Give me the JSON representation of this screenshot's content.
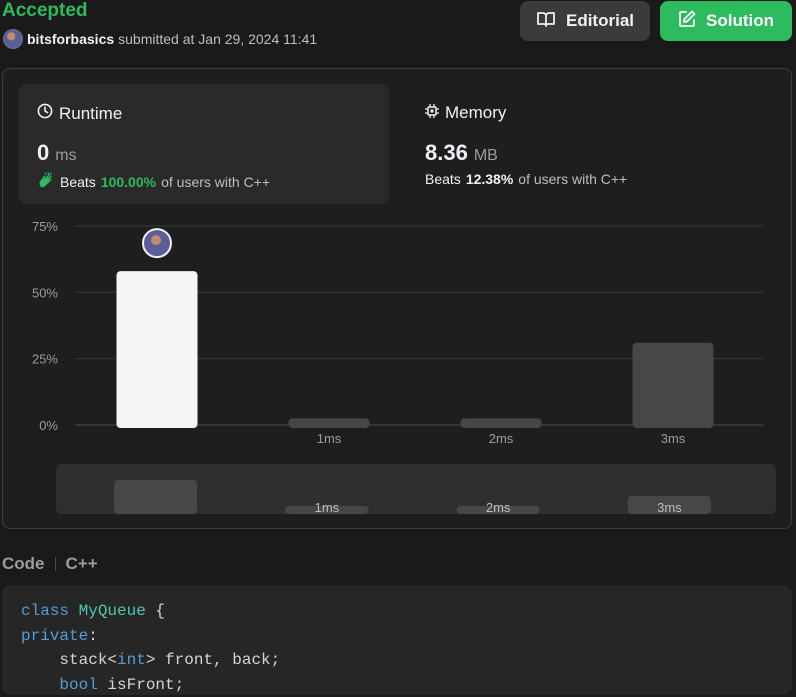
{
  "submission": {
    "status": "Accepted",
    "username": "bitsforbasics",
    "submitted_text": "submitted at Jan 29, 2024 11:41"
  },
  "buttons": {
    "editorial": "Editorial",
    "solution": "Solution"
  },
  "runtime": {
    "title": "Runtime",
    "value": "0",
    "unit": "ms",
    "beats_label": "Beats",
    "percent": "100.00%",
    "suffix": "of users with C++"
  },
  "memory": {
    "title": "Memory",
    "value": "8.36",
    "unit": "MB",
    "beats_label": "Beats",
    "percent": "12.38%",
    "suffix": "of users with C++"
  },
  "chart_data": {
    "type": "bar",
    "yticks": [
      "75%",
      "50%",
      "25%",
      "0%"
    ],
    "ylim": [
      0,
      75
    ],
    "categories": [
      "",
      "1ms",
      "2ms",
      "3ms"
    ],
    "values": [
      58,
      2.5,
      2.5,
      31
    ],
    "highlight_index": 0,
    "grid": true
  },
  "overview": {
    "labels": [
      "",
      "1ms",
      "2ms",
      "3ms"
    ]
  },
  "code": {
    "section_label": "Code",
    "language": "C++",
    "lines": [
      [
        {
          "t": "class ",
          "c": "kw"
        },
        {
          "t": "MyQueue",
          "c": "ty"
        },
        {
          "t": " {",
          "c": ""
        }
      ],
      [
        {
          "t": "private",
          "c": "kw"
        },
        {
          "t": ":",
          "c": ""
        }
      ],
      [
        {
          "t": "    stack<",
          "c": ""
        },
        {
          "t": "int",
          "c": "kw"
        },
        {
          "t": "> front, back;",
          "c": ""
        }
      ],
      [
        {
          "t": "    ",
          "c": ""
        },
        {
          "t": "bool",
          "c": "kw"
        },
        {
          "t": " isFront;",
          "c": ""
        }
      ]
    ]
  },
  "colors": {
    "accent_green": "#2cbb5d",
    "bar_highlight": "#f5f5f5",
    "bar_default": "#474747"
  },
  "icons": {
    "runtime": "clock-icon",
    "memory": "chip-icon",
    "beats": "clap-icon",
    "editorial": "book-icon",
    "solution": "edit-icon"
  }
}
